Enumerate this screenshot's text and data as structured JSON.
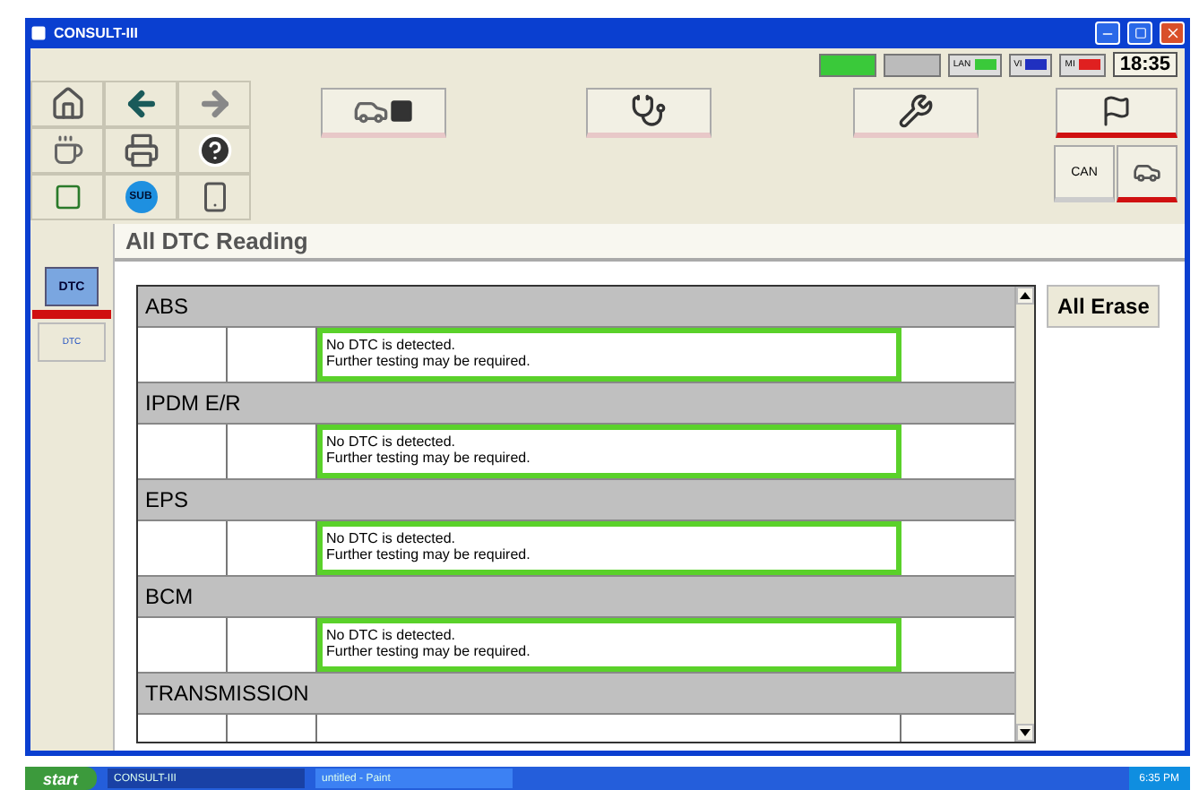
{
  "window": {
    "title": "CONSULT-III"
  },
  "status": {
    "indicators": [
      "LAN",
      "VI",
      "MI"
    ],
    "clock": "18:35"
  },
  "toolbar": {
    "sub_label": "SUB",
    "can_label": "CAN"
  },
  "sidebar": {
    "dtc_label": "DTC",
    "small_label": "DTC"
  },
  "page": {
    "title": "All DTC Reading"
  },
  "modules": [
    {
      "name": "ABS",
      "message": [
        "No DTC is detected.",
        "Further testing may be required."
      ]
    },
    {
      "name": "IPDM E/R",
      "message": [
        "No DTC is detected.",
        "Further testing may be required."
      ]
    },
    {
      "name": "EPS",
      "message": [
        "No DTC is detected.",
        "Further testing may be required."
      ]
    },
    {
      "name": "BCM",
      "message": [
        "No DTC is detected.",
        "Further testing may be required."
      ]
    },
    {
      "name": "TRANSMISSION"
    }
  ],
  "all_erase": "All Erase",
  "taskbar": {
    "start": "start",
    "tasks": [
      {
        "label": "CONSULT-III",
        "selected": true
      },
      {
        "label": "untitled - Paint",
        "selected": false
      }
    ],
    "clock": "6:35 PM"
  }
}
